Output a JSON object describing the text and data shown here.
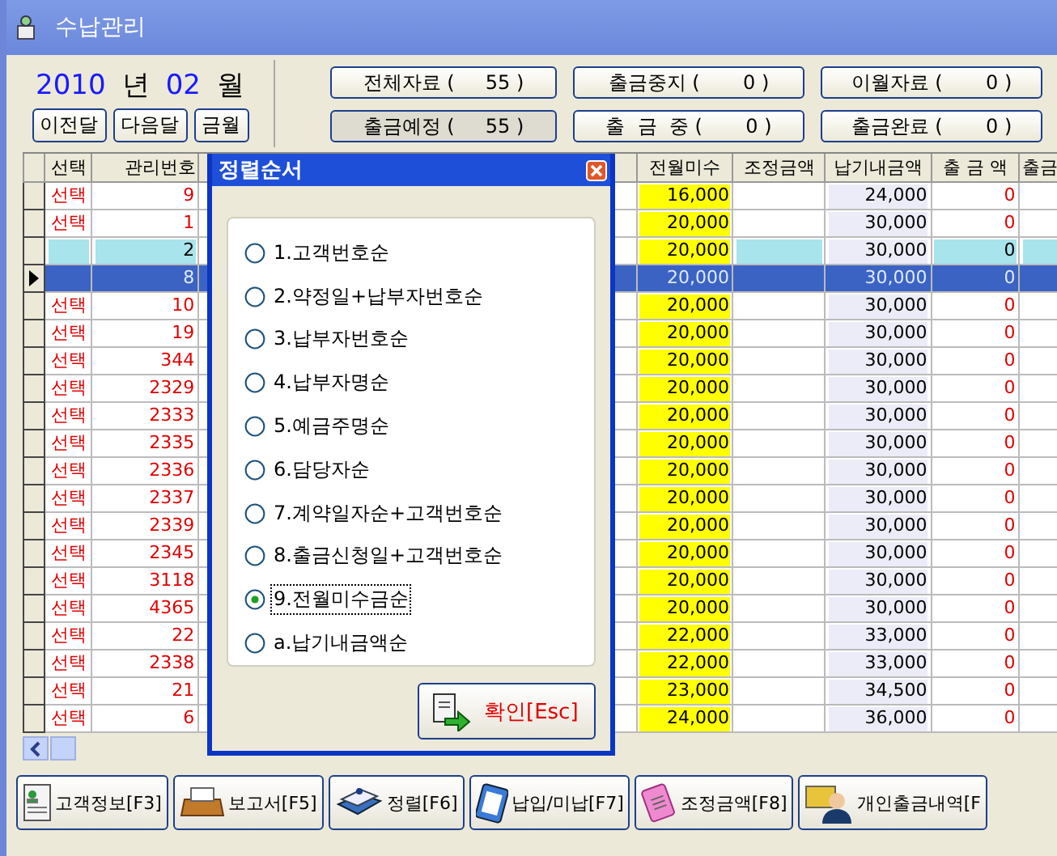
{
  "window": {
    "title": "수납관리"
  },
  "period": {
    "year": "2010",
    "year_unit": "년",
    "month": "02",
    "month_unit": "월"
  },
  "nav_buttons": [
    "이전달",
    "다음달",
    "금월"
  ],
  "stat_buttons": [
    {
      "text": "전체자료 (     55 )",
      "selected": false
    },
    {
      "text": "출금중지 (       0 )",
      "selected": false
    },
    {
      "text": "이월자료 (       0 )",
      "selected": false
    },
    {
      "text": "출금예정 (     55 )",
      "selected": true
    },
    {
      "text": "출  금  중 (       0 )",
      "selected": false
    },
    {
      "text": "출금완료 (       0 )",
      "selected": false
    }
  ],
  "table": {
    "columns": [
      "선택",
      "관리번호",
      "전월미수",
      "조정금액",
      "납기내금액",
      "출 금 액",
      "출금"
    ],
    "rows": [
      {
        "kind": "normal",
        "selected": false,
        "select": "선택",
        "id": "9",
        "prev_unpaid": "16,000",
        "due_amount": "24,000",
        "paid": "0"
      },
      {
        "kind": "normal",
        "selected": false,
        "select": "선택",
        "id": "1",
        "prev_unpaid": "20,000",
        "due_amount": "30,000",
        "paid": "0"
      },
      {
        "kind": "marked",
        "selected": false,
        "id": "2",
        "prev_unpaid": "20,000",
        "due_amount": "30,000",
        "paid": "0"
      },
      {
        "kind": "normal",
        "selected": true,
        "id": "8",
        "prev_unpaid": "20,000",
        "due_amount": "30,000",
        "paid": "0"
      },
      {
        "kind": "normal",
        "selected": false,
        "select": "선택",
        "id": "10",
        "prev_unpaid": "20,000",
        "due_amount": "30,000",
        "paid": "0"
      },
      {
        "kind": "normal",
        "selected": false,
        "select": "선택",
        "id": "19",
        "prev_unpaid": "20,000",
        "due_amount": "30,000",
        "paid": "0"
      },
      {
        "kind": "normal",
        "selected": false,
        "select": "선택",
        "id": "344",
        "prev_unpaid": "20,000",
        "due_amount": "30,000",
        "paid": "0"
      },
      {
        "kind": "normal",
        "selected": false,
        "select": "선택",
        "id": "2329",
        "prev_unpaid": "20,000",
        "due_amount": "30,000",
        "paid": "0"
      },
      {
        "kind": "normal",
        "selected": false,
        "select": "선택",
        "id": "2333",
        "prev_unpaid": "20,000",
        "due_amount": "30,000",
        "paid": "0"
      },
      {
        "kind": "normal",
        "selected": false,
        "select": "선택",
        "id": "2335",
        "prev_unpaid": "20,000",
        "due_amount": "30,000",
        "paid": "0"
      },
      {
        "kind": "normal",
        "selected": false,
        "select": "선택",
        "id": "2336",
        "prev_unpaid": "20,000",
        "due_amount": "30,000",
        "paid": "0"
      },
      {
        "kind": "normal",
        "selected": false,
        "select": "선택",
        "id": "2337",
        "prev_unpaid": "20,000",
        "due_amount": "30,000",
        "paid": "0"
      },
      {
        "kind": "normal",
        "selected": false,
        "select": "선택",
        "id": "2339",
        "prev_unpaid": "20,000",
        "due_amount": "30,000",
        "paid": "0"
      },
      {
        "kind": "normal",
        "selected": false,
        "select": "선택",
        "id": "2345",
        "prev_unpaid": "20,000",
        "due_amount": "30,000",
        "paid": "0"
      },
      {
        "kind": "normal",
        "selected": false,
        "select": "선택",
        "id": "3118",
        "prev_unpaid": "20,000",
        "due_amount": "30,000",
        "paid": "0"
      },
      {
        "kind": "normal",
        "selected": false,
        "select": "선택",
        "id": "4365",
        "prev_unpaid": "20,000",
        "due_amount": "30,000",
        "paid": "0"
      },
      {
        "kind": "normal",
        "selected": false,
        "select": "선택",
        "id": "22",
        "prev_unpaid": "22,000",
        "due_amount": "33,000",
        "paid": "0"
      },
      {
        "kind": "normal",
        "selected": false,
        "select": "선택",
        "id": "2338",
        "prev_unpaid": "22,000",
        "due_amount": "33,000",
        "paid": "0"
      },
      {
        "kind": "normal",
        "selected": false,
        "select": "선택",
        "id": "21",
        "prev_unpaid": "23,000",
        "due_amount": "34,500",
        "paid": "0"
      },
      {
        "kind": "normal",
        "selected": false,
        "select": "선택",
        "id": "6",
        "prev_unpaid": "24,000",
        "due_amount": "36,000",
        "paid": "0"
      }
    ]
  },
  "dialog": {
    "title": "정렬순서",
    "options": [
      {
        "label": "1.고객번호순",
        "selected": false
      },
      {
        "label": "2.약정일+납부자번호순",
        "selected": false
      },
      {
        "label": "3.납부자번호순",
        "selected": false
      },
      {
        "label": "4.납부자명순",
        "selected": false
      },
      {
        "label": "5.예금주명순",
        "selected": false
      },
      {
        "label": "6.담당자순",
        "selected": false
      },
      {
        "label": "7.계약일자순+고객번호순",
        "selected": false
      },
      {
        "label": "8.출금신청일+고객번호순",
        "selected": false
      },
      {
        "label": "9.전월미수금순",
        "selected": true
      },
      {
        "label": "a.납기내금액순",
        "selected": false
      }
    ],
    "confirm": "확인[Esc]"
  },
  "bottom_buttons": [
    {
      "kind": "customer",
      "label": "고객정보[F3]"
    },
    {
      "kind": "report",
      "label": "보고서[F5]"
    },
    {
      "kind": "sort",
      "label": "정렬[F6]"
    },
    {
      "kind": "payment",
      "label": "납입/미납[F7]"
    },
    {
      "kind": "adjust",
      "label": "조정금액[F8]"
    },
    {
      "kind": "personal",
      "label": "개인출금내역[F"
    }
  ]
}
